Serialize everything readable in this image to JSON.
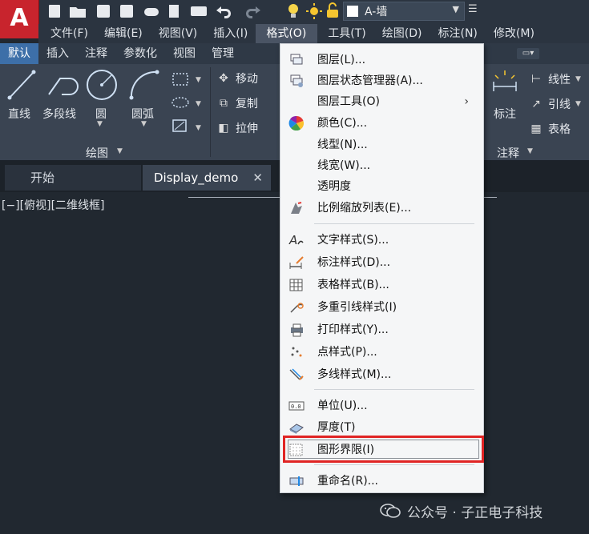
{
  "app": {
    "logo_letter": "A"
  },
  "layer_combo": {
    "name": "A-墙"
  },
  "menubar": [
    {
      "key": "file",
      "label": "文件(F)"
    },
    {
      "key": "edit",
      "label": "编辑(E)"
    },
    {
      "key": "view",
      "label": "视图(V)"
    },
    {
      "key": "insert",
      "label": "插入(I)"
    },
    {
      "key": "format",
      "label": "格式(O)",
      "active": true
    },
    {
      "key": "tools",
      "label": "工具(T)"
    },
    {
      "key": "draw",
      "label": "绘图(D)"
    },
    {
      "key": "dimension",
      "label": "标注(N)"
    },
    {
      "key": "modify",
      "label": "修改(M)"
    }
  ],
  "ribbon_tabs": [
    {
      "label": "默认",
      "active": true
    },
    {
      "label": "插入"
    },
    {
      "label": "注释"
    },
    {
      "label": "参数化"
    },
    {
      "label": "视图"
    },
    {
      "label": "管理"
    }
  ],
  "ribbon": {
    "draw_tools": {
      "line": "直线",
      "polyline": "多段线",
      "circle": "圆",
      "arc": "圆弧"
    },
    "draw_panel_title": "绘图",
    "modify_tools": {
      "move": "移动",
      "copy": "复制",
      "stretch": "拉伸"
    },
    "annotation_tools": {
      "linear": "线性",
      "leader": "引线",
      "table": "表格",
      "dim": "标注"
    },
    "annotation_panel_title": "注释"
  },
  "doc_tabs": {
    "start": "开始",
    "active": "Display_demo"
  },
  "viewport_label": "[−][俯视][二维线框]",
  "format_menu": {
    "items": [
      {
        "label": "图层(L)...",
        "icon": "layers-icon"
      },
      {
        "label": "图层状态管理器(A)...",
        "icon": "layer-states-icon"
      },
      {
        "label": "图层工具(O)",
        "icon": "",
        "submenu": true
      },
      {
        "label": "颜色(C)...",
        "icon": "color-wheel-icon"
      },
      {
        "label": "线型(N)...",
        "icon": ""
      },
      {
        "label": "线宽(W)...",
        "icon": ""
      },
      {
        "label": "透明度",
        "icon": ""
      },
      {
        "label": "比例缩放列表(E)...",
        "icon": "scale-list-icon"
      },
      {
        "label": "文字样式(S)...",
        "icon": "text-style-icon"
      },
      {
        "label": "标注样式(D)...",
        "icon": "dim-style-icon"
      },
      {
        "label": "表格样式(B)...",
        "icon": "table-style-icon"
      },
      {
        "label": "多重引线样式(I)",
        "icon": "mleader-style-icon"
      },
      {
        "label": "打印样式(Y)...",
        "icon": "plot-style-icon"
      },
      {
        "label": "点样式(P)...",
        "icon": "point-style-icon"
      },
      {
        "label": "多线样式(M)...",
        "icon": "mline-style-icon"
      },
      {
        "label": "单位(U)...",
        "icon": "units-icon"
      },
      {
        "label": "厚度(T)",
        "icon": "thickness-icon"
      },
      {
        "label": "图形界限(I)",
        "icon": "drawing-limits-icon",
        "highlighted": true
      },
      {
        "label": "重命名(R)...",
        "icon": "rename-icon"
      }
    ],
    "submenu_arrow": "›",
    "highlight_color": "#e02424"
  },
  "watermark": {
    "text": "公众号 · 子正电子科技"
  }
}
